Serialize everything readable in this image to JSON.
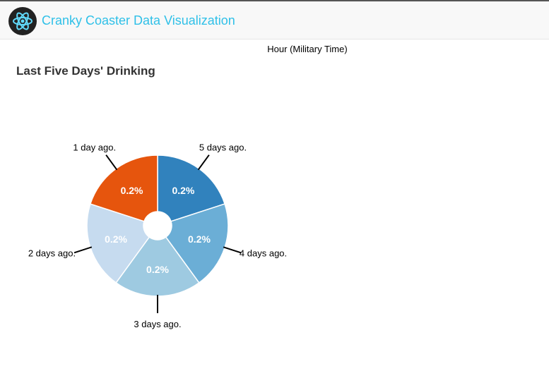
{
  "header": {
    "brand": "Cranky Coaster Data Visualization",
    "logo_icon": "react-atom-icon"
  },
  "axis_label": "Hour (Military Time)",
  "chart_data": {
    "type": "pie",
    "title": "Last Five Days' Drinking",
    "donut": true,
    "slices": [
      {
        "label": "5 days ago.",
        "value": 0.2,
        "display": "0.2%",
        "color": "#3182bd"
      },
      {
        "label": "4 days ago.",
        "value": 0.2,
        "display": "0.2%",
        "color": "#6baed6"
      },
      {
        "label": "3 days ago.",
        "value": 0.2,
        "display": "0.2%",
        "color": "#9ecae1"
      },
      {
        "label": "2 days ago.",
        "value": 0.2,
        "display": "0.2%",
        "color": "#c6dbef"
      },
      {
        "label": "1 day ago.",
        "value": 0.2,
        "display": "0.2%",
        "color": "#e6550d"
      }
    ]
  }
}
